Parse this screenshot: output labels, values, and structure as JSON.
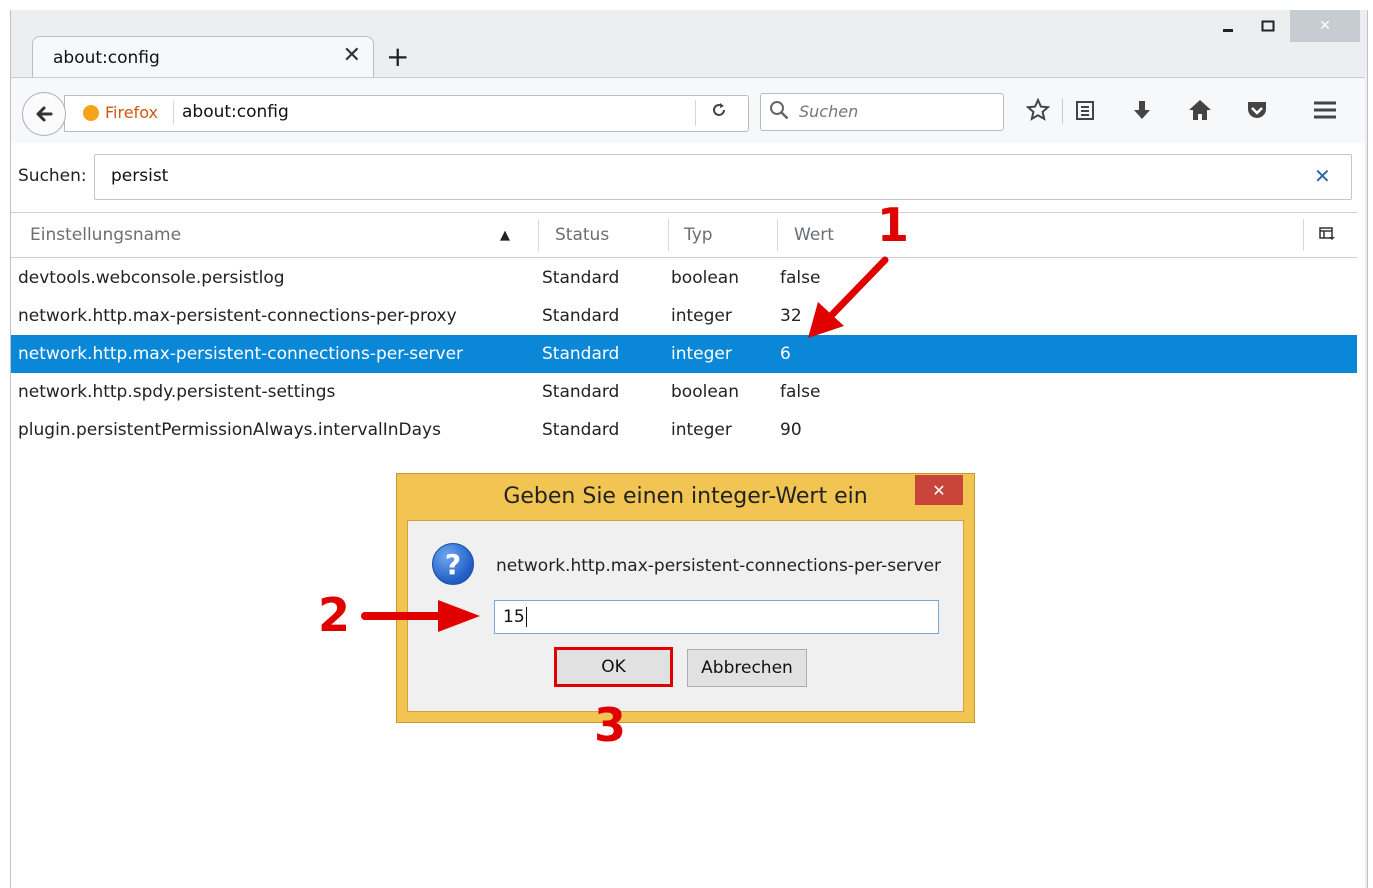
{
  "window": {
    "minimize_icon": "minimize-icon",
    "maximize_icon": "maximize-icon",
    "close_icon": "close-icon",
    "close_symbol": "✕"
  },
  "tab": {
    "title": "about:config",
    "close_symbol": "✕",
    "new_tab_symbol": "+"
  },
  "navbar": {
    "back_icon": "back-arrow-icon",
    "identity_label": "Firefox",
    "url": "about:config",
    "reload_icon": "reload-icon",
    "search_placeholder": "Suchen",
    "toolbar_icons": [
      "bookmark-star-icon",
      "reading-list-icon",
      "download-icon",
      "home-icon",
      "pocket-icon",
      "menu-icon"
    ]
  },
  "filter": {
    "label": "Suchen:",
    "value": "persist",
    "clear_symbol": "✕"
  },
  "table": {
    "headers": {
      "name": "Einstellungsname",
      "status": "Status",
      "type": "Typ",
      "value": "Wert"
    },
    "sort_indicator": "▲",
    "column_picker_icon": "column-picker-icon",
    "rows": [
      {
        "name": "devtools.webconsole.persistlog",
        "status": "Standard",
        "type": "boolean",
        "value": "false",
        "selected": false
      },
      {
        "name": "network.http.max-persistent-connections-per-proxy",
        "status": "Standard",
        "type": "integer",
        "value": "32",
        "selected": false
      },
      {
        "name": "network.http.max-persistent-connections-per-server",
        "status": "Standard",
        "type": "integer",
        "value": "6",
        "selected": true
      },
      {
        "name": "network.http.spdy.persistent-settings",
        "status": "Standard",
        "type": "boolean",
        "value": "false",
        "selected": false
      },
      {
        "name": "plugin.persistentPermissionAlways.intervalInDays",
        "status": "Standard",
        "type": "integer",
        "value": "90",
        "selected": false
      }
    ]
  },
  "dialog": {
    "title": "Geben Sie einen integer-Wert ein",
    "close_symbol": "✕",
    "question_symbol": "?",
    "message": "network.http.max-persistent-connections-per-server",
    "input_value": "15",
    "ok_label": "OK",
    "cancel_label": "Abbrechen"
  },
  "annotations": {
    "step1": "1",
    "step2": "2",
    "step3": "3",
    "color": "#e00000"
  },
  "colors": {
    "selection": "#0a87d6",
    "dialog_frame": "#f2c552",
    "dialog_close": "#c9443b"
  }
}
